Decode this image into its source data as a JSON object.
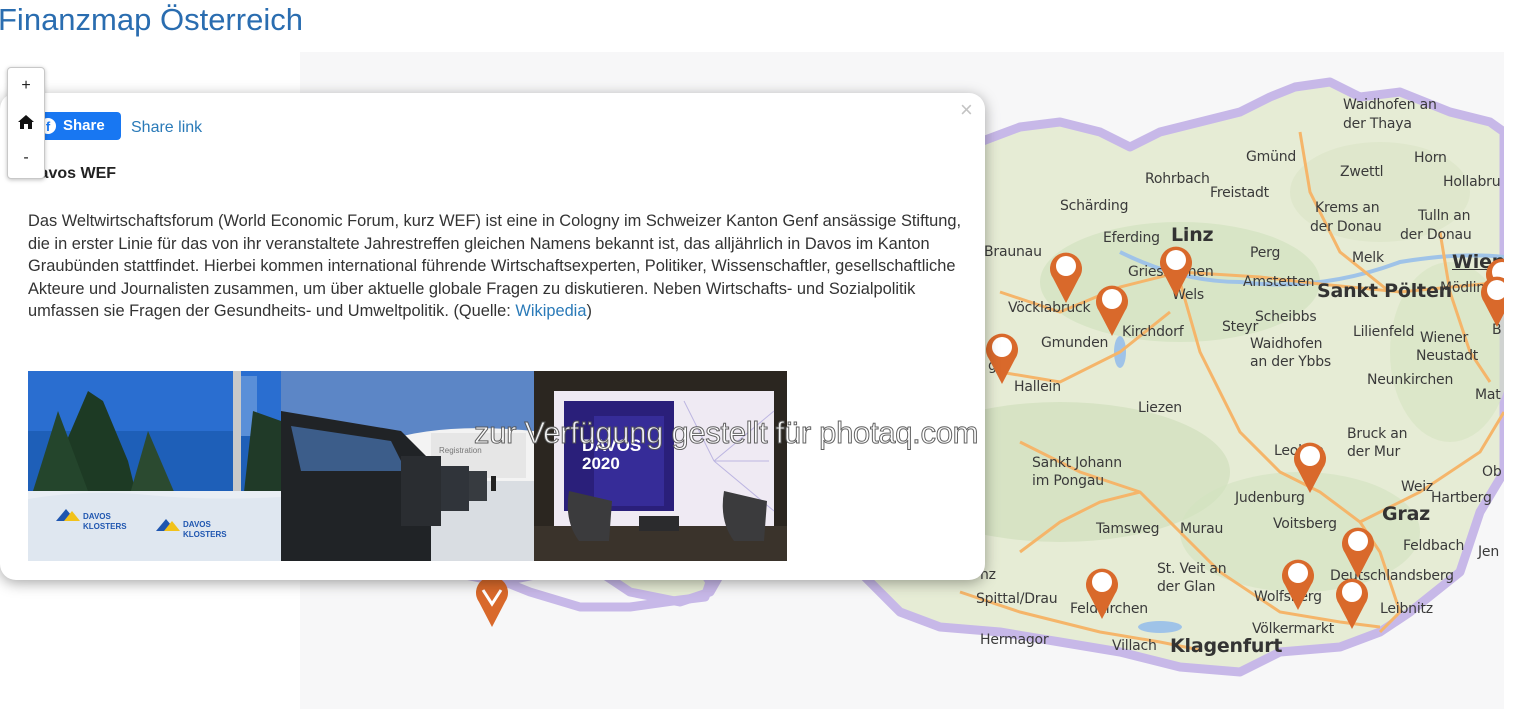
{
  "page": {
    "title": "Finanzmap Österreich"
  },
  "zoom_controls": {
    "zoom_in": "+",
    "home_icon": "home-icon",
    "zoom_out": "-"
  },
  "popup": {
    "share_button": "Share",
    "share_link": "Share link",
    "close": "×",
    "title": "Davos WEF",
    "body_text": "Das Weltwirtschaftsforum (World Economic Forum, kurz WEF) ist eine in Cologny im Schweizer Kanton Genf ansässige Stiftung, die in erster Linie für das von ihr veranstaltete Jahrestreffen gleichen Namens bekannt ist, das alljährlich in Davos im Kanton Graubünden stattfindet. Hierbei kommen international führende Wirtschaftsexperten, Politiker, Wissenschaftler, gesellschaftliche Akteure und Journalisten zusammen, um über aktuelle globale Fragen zu diskutieren. Neben Wirtschafts- und Sozialpolitik umfassen sie Fragen der Gesundheits- und Umweltpolitik. (Quelle: ",
    "source_link": "Wikipedia",
    "body_end": ")",
    "images": [
      {
        "name": "photo-davos-klosters-banner",
        "texts": [
          "DAVOS",
          "KLOSTERS",
          "DAVOS",
          "KLOSTERS"
        ]
      },
      {
        "name": "photo-registration-cars",
        "texts": [
          "Registration"
        ]
      },
      {
        "name": "photo-davos-2020-stage",
        "texts": [
          "DAVOS",
          "2020"
        ]
      }
    ]
  },
  "watermark": "zur Verfügung gestellt für photaq.com",
  "map": {
    "places": [
      "Waidhofen an",
      "der Thaya",
      "Gmünd",
      "Horn",
      "Rohrbach",
      "Zwettl",
      "Hollabru",
      "Freistadt",
      "Schärding",
      "Krems an",
      "der Donau",
      "Tulln an",
      "der Donau",
      "Eferding",
      "Linz",
      "Braunau",
      "Perg",
      "Melk",
      "Grieskirchen",
      "Wien",
      "Amstetten",
      "Wels",
      "Sankt Pölten",
      "Mödling",
      "Vöcklabruck",
      "Scheibbs",
      "Steyr",
      "Lilienfeld",
      "Wiener",
      "Neustadt",
      "Kirchdorf",
      "Gmunden",
      "Waidhofen",
      "an der Ybbs",
      "Neunkirchen",
      "Hallein",
      "Liezen",
      "Mat",
      "Bruck an",
      "der Mur",
      "Leoben",
      "Ob",
      "Sankt Johann",
      "im Pongau",
      "Weiz",
      "Hartberg",
      "Judenburg",
      "Graz",
      "Tamsweg",
      "Murau",
      "Voitsberg",
      "Feldbach",
      "Jen",
      "Deutschlandsberg",
      "St. Veit an",
      "der Glan",
      "nz",
      "Spittal/Drau",
      "Feldkirchen",
      "Wolfsberg",
      "Leibnitz",
      "Völkermarkt",
      "Hermagor",
      "Villach",
      "Klagenfurt",
      "B",
      "g"
    ],
    "marker_count": 13,
    "marker_color": "#d9692b",
    "road_color": "#f5b56a",
    "border_color": "#c7b8e8",
    "land_color": "#e8eed8"
  }
}
